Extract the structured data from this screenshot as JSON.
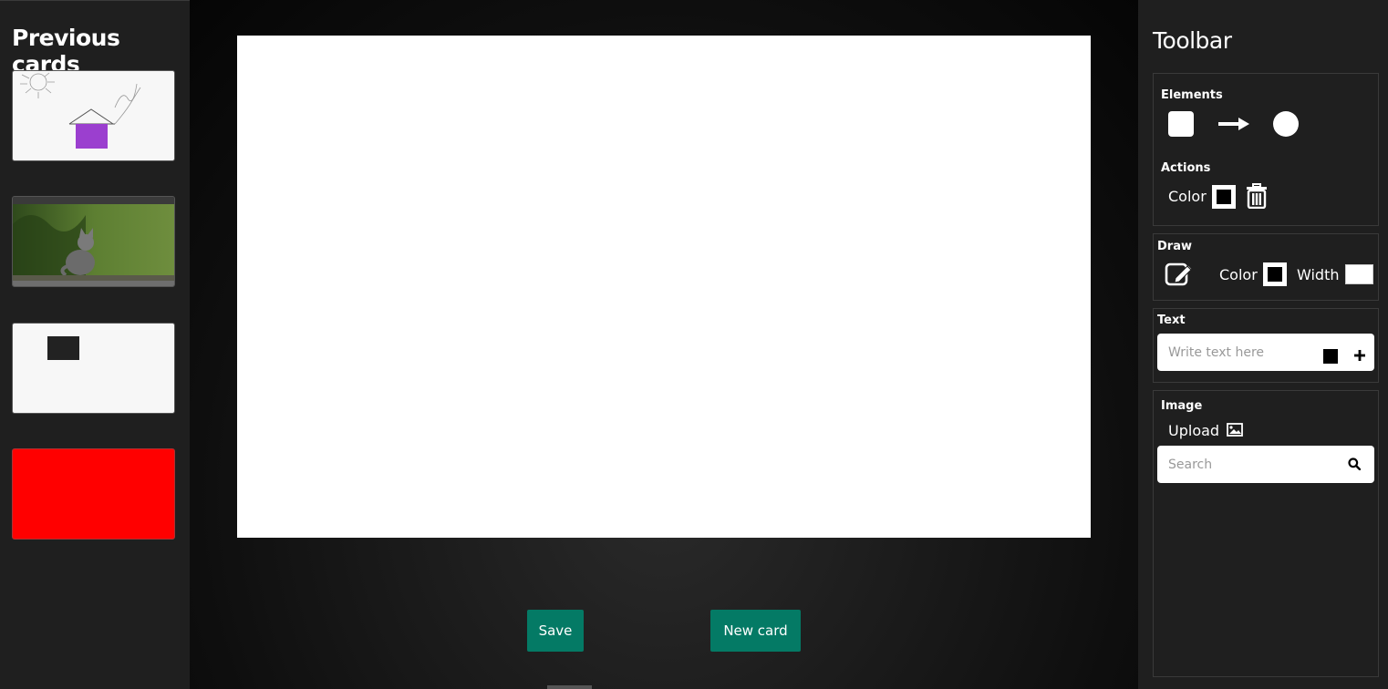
{
  "left": {
    "title": "Previous cards"
  },
  "center": {
    "save_label": "Save",
    "new_card_label": "New card"
  },
  "toolbar": {
    "title": "Toolbar",
    "elements": {
      "label": "Elements"
    },
    "actions": {
      "label": "Actions",
      "color_label": "Color"
    },
    "draw": {
      "label": "Draw",
      "color_label": "Color",
      "width_label": "Width"
    },
    "text": {
      "label": "Text",
      "placeholder": "Write text here"
    },
    "image": {
      "label": "Image",
      "upload_label": "Upload",
      "search_placeholder": "Search"
    }
  },
  "colors": {
    "accent_button": "#047a65",
    "thumb_house_fill": "#9b3fcf",
    "thumb_red": "#ff0000"
  }
}
